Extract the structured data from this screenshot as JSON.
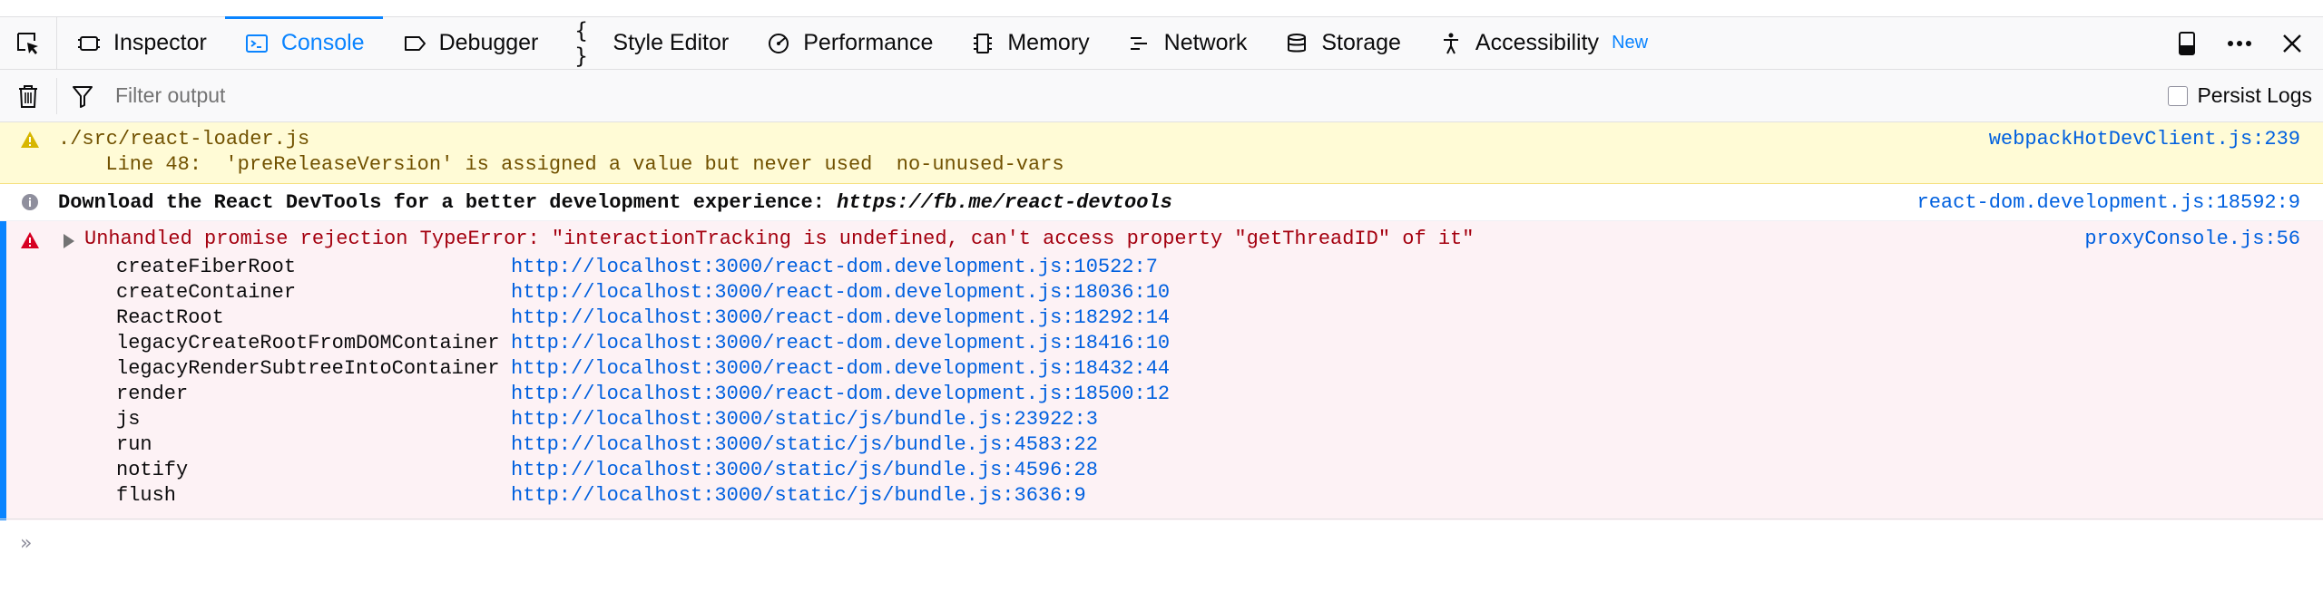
{
  "toolbar": {
    "tabs": [
      {
        "label": "Inspector",
        "icon": "inspector-icon"
      },
      {
        "label": "Console",
        "icon": "console-icon",
        "selected": true
      },
      {
        "label": "Debugger",
        "icon": "debugger-icon"
      },
      {
        "label": "Style Editor",
        "icon": "style-editor-icon"
      },
      {
        "label": "Performance",
        "icon": "performance-icon"
      },
      {
        "label": "Memory",
        "icon": "memory-icon"
      },
      {
        "label": "Network",
        "icon": "network-icon"
      },
      {
        "label": "Storage",
        "icon": "storage-icon"
      },
      {
        "label": "Accessibility",
        "icon": "accessibility-icon",
        "badge": "New"
      }
    ]
  },
  "filter": {
    "placeholder": "Filter output",
    "persist_logs_label": "Persist Logs"
  },
  "messages": {
    "warning": {
      "file": "./src/react-loader.js",
      "detail": "  Line 48:  'preReleaseVersion' is assigned a value but never used  no-unused-vars",
      "source": "webpackHotDevClient.js:239"
    },
    "info": {
      "text": "Download the React DevTools for a better development experience: ",
      "link": "https://fb.me/react-devtools",
      "source": "react-dom.development.js:18592:9"
    },
    "error": {
      "text": "Unhandled promise rejection TypeError: \"interactionTracking is undefined, can't access property \"getThreadID\" of it\"",
      "source": "proxyConsole.js:56",
      "frames": [
        {
          "fn": "createFiberRoot",
          "loc": "http://localhost:3000/react-dom.development.js:10522:7"
        },
        {
          "fn": "createContainer",
          "loc": "http://localhost:3000/react-dom.development.js:18036:10"
        },
        {
          "fn": "ReactRoot",
          "loc": "http://localhost:3000/react-dom.development.js:18292:14"
        },
        {
          "fn": "legacyCreateRootFromDOMContainer",
          "loc": "http://localhost:3000/react-dom.development.js:18416:10"
        },
        {
          "fn": "legacyRenderSubtreeIntoContainer",
          "loc": "http://localhost:3000/react-dom.development.js:18432:44"
        },
        {
          "fn": "render",
          "loc": "http://localhost:3000/react-dom.development.js:18500:12"
        },
        {
          "fn": "js",
          "loc": "http://localhost:3000/static/js/bundle.js:23922:3"
        },
        {
          "fn": "run",
          "loc": "http://localhost:3000/static/js/bundle.js:4583:22"
        },
        {
          "fn": "notify",
          "loc": "http://localhost:3000/static/js/bundle.js:4596:28"
        },
        {
          "fn": "flush",
          "loc": "http://localhost:3000/static/js/bundle.js:3636:9"
        }
      ]
    }
  },
  "colors": {
    "accent": "#0a84ff",
    "warning_bg": "#fffbd6",
    "error_bg": "#fdf2f5",
    "error_text": "#a4000f",
    "link": "#0060df"
  }
}
